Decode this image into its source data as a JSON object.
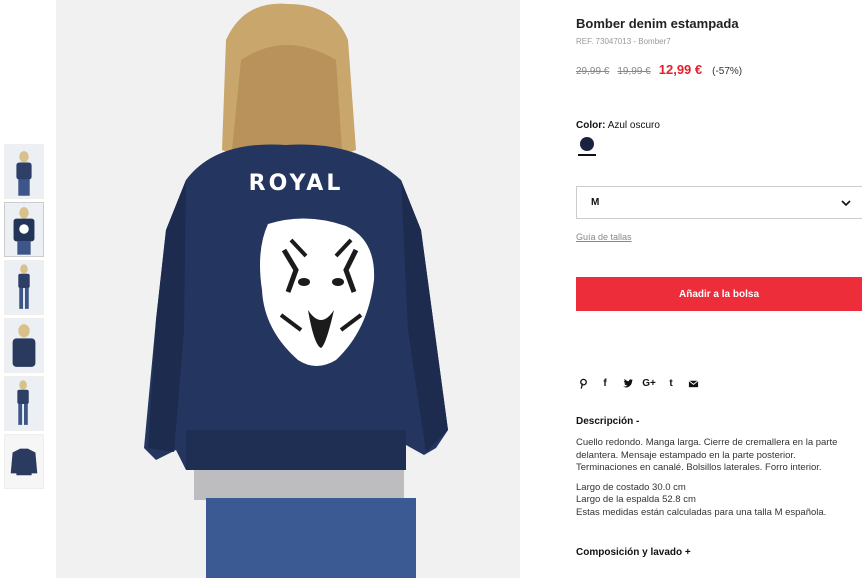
{
  "product": {
    "title": "Bomber denim estampada",
    "ref": "REF. 73047013 - Bomber7",
    "old_price_1": "29,99 €",
    "old_price_2": "19,99 €",
    "sale_price": "12,99 €",
    "discount": "(-57%)"
  },
  "color": {
    "label": "Color:",
    "value": "Azul oscuro",
    "swatch_hex": "#1a2240"
  },
  "size": {
    "selected": "M",
    "guide_link": "Guía de tallas"
  },
  "cta": {
    "add_to_bag": "Añadir a la bolsa",
    "accent_hex": "#ee2d3b"
  },
  "share": {
    "icons": [
      "pinterest-icon",
      "facebook-icon",
      "twitter-icon",
      "google-plus-icon",
      "tumblr-icon",
      "email-icon"
    ],
    "google_plus_label": "G+",
    "facebook_label": "f",
    "tumblr_label": "t"
  },
  "description": {
    "title": "Descripción -",
    "line1": "Cuello redondo. Manga larga. Cierre de cremallera en la parte",
    "line2": "delantera. Mensaje estampado en la parte posterior.",
    "line3": "Terminaciones en canalé. Bolsillos laterales. Forro interior.",
    "measure1": "Largo de costado 30.0 cm",
    "measure2": "Largo de la espalda 52.8 cm",
    "measure3": "Estas medidas están calculadas para una talla M española."
  },
  "composition": {
    "title": "Composición y lavado +"
  },
  "image": {
    "print_text": "ROYAL"
  }
}
